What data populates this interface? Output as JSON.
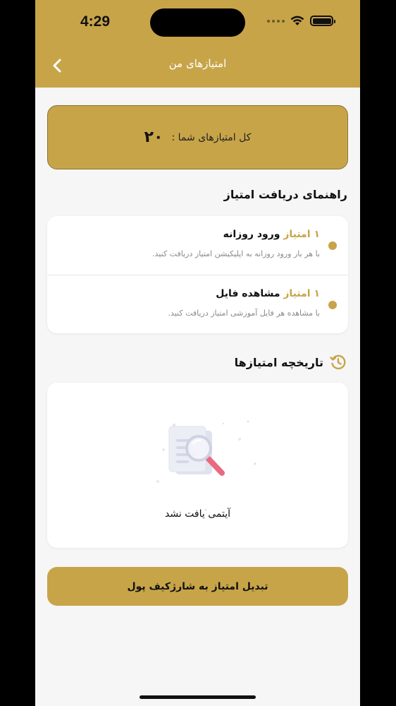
{
  "status_bar": {
    "time": "4:29"
  },
  "header": {
    "title": "امتیازهای من"
  },
  "points_card": {
    "label": "کل امتیازهای شما :",
    "value": "۲۰"
  },
  "guide": {
    "title": "راهنمای دریافت امتیاز",
    "items": [
      {
        "points": "۱ امتیاز",
        "name": "ورود روزانه",
        "description": "با هر بار ورود روزانه به اپلیکیشن امتیاز دریافت کنید."
      },
      {
        "points": "۱ امتیاز",
        "name": "مشاهده فایل",
        "description": "با مشاهده هر فایل آموزشی امتیاز دریافت کنید."
      }
    ]
  },
  "history": {
    "title": "تاریخچه امتیازها",
    "empty_text": "آیتمی یافت نشد"
  },
  "actions": {
    "convert_label": "تبدیل امتیاز به شارژکیف پول"
  },
  "colors": {
    "accent": "#c8a449",
    "background": "#f6f6f6",
    "card": "#ffffff"
  },
  "icons": {
    "back": "chevron-left-icon",
    "history": "history-icon",
    "wifi": "wifi-icon",
    "battery": "battery-icon"
  }
}
